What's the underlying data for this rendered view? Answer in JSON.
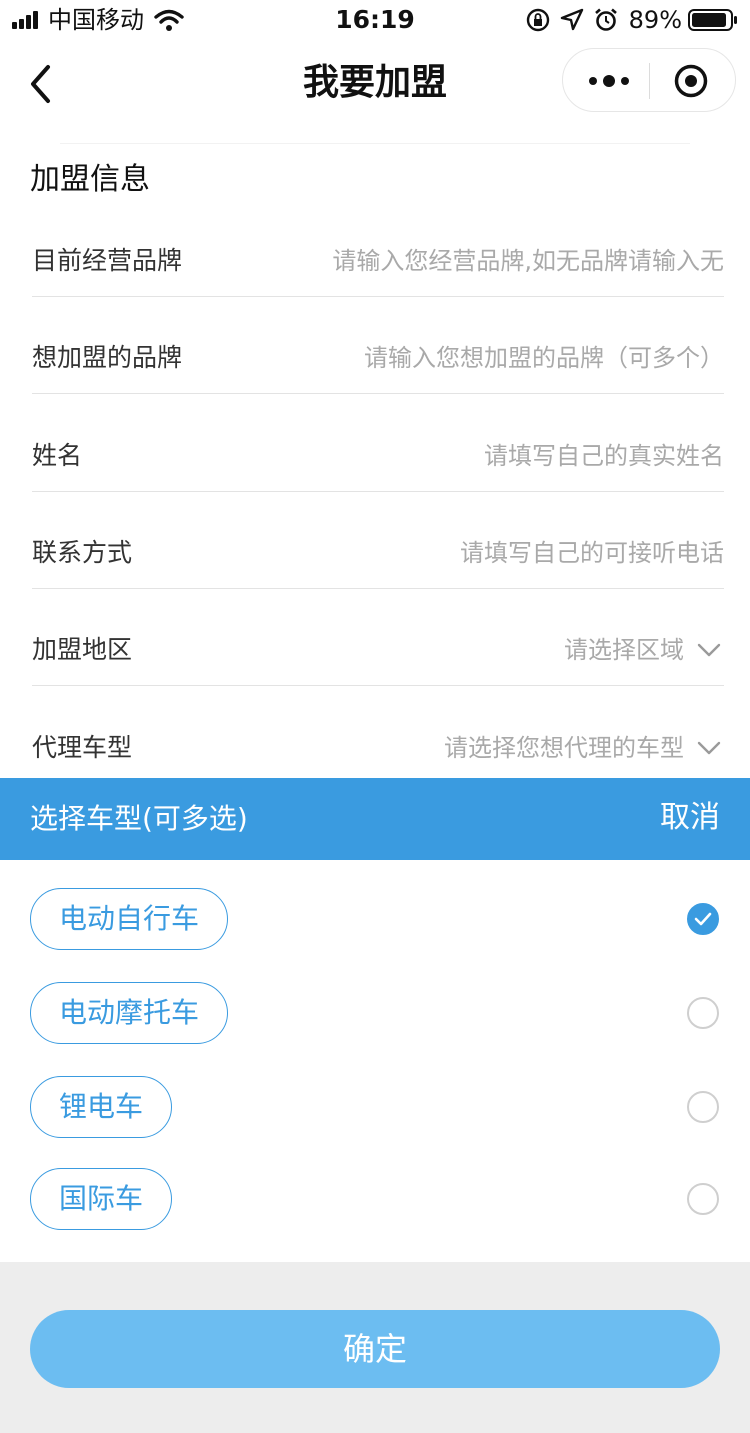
{
  "status_bar": {
    "carrier": "中国移动",
    "time": "16:19",
    "battery": "89%",
    "icons": [
      "signal-icon",
      "wifi-icon",
      "orientation-lock-icon",
      "location-arrow-icon",
      "alarm-icon",
      "battery-icon"
    ]
  },
  "nav": {
    "title": "我要加盟",
    "icons": [
      "back-chevron-icon",
      "more-dots-icon",
      "target-circle-icon"
    ]
  },
  "form": {
    "section_title": "加盟信息",
    "rows": [
      {
        "label": "目前经营品牌",
        "placeholder": "请输入您经营品牌,如无品牌请输入无"
      },
      {
        "label": "想加盟的品牌",
        "placeholder": "请输入您想加盟的品牌（可多个）"
      },
      {
        "label": "姓名",
        "placeholder": "请填写自己的真实姓名"
      },
      {
        "label": "联系方式",
        "placeholder": "请填写自己的可接听电话"
      },
      {
        "label": "加盟地区",
        "value": "请选择区域"
      },
      {
        "label": "代理车型",
        "value": "请选择您想代理的车型"
      }
    ]
  },
  "picker": {
    "title": "选择车型(可多选)",
    "cancel": "取消",
    "options": [
      {
        "label": "电动自行车",
        "checked": true
      },
      {
        "label": "电动摩托车",
        "checked": false
      },
      {
        "label": "锂电车",
        "checked": false
      },
      {
        "label": "国际车",
        "checked": false
      }
    ],
    "confirm": "确定"
  },
  "colors": {
    "accent": "#3a9be0",
    "confirm_bg": "#6cbdf1",
    "placeholder": "#a9a9a9",
    "footer_bg": "#ededed"
  }
}
